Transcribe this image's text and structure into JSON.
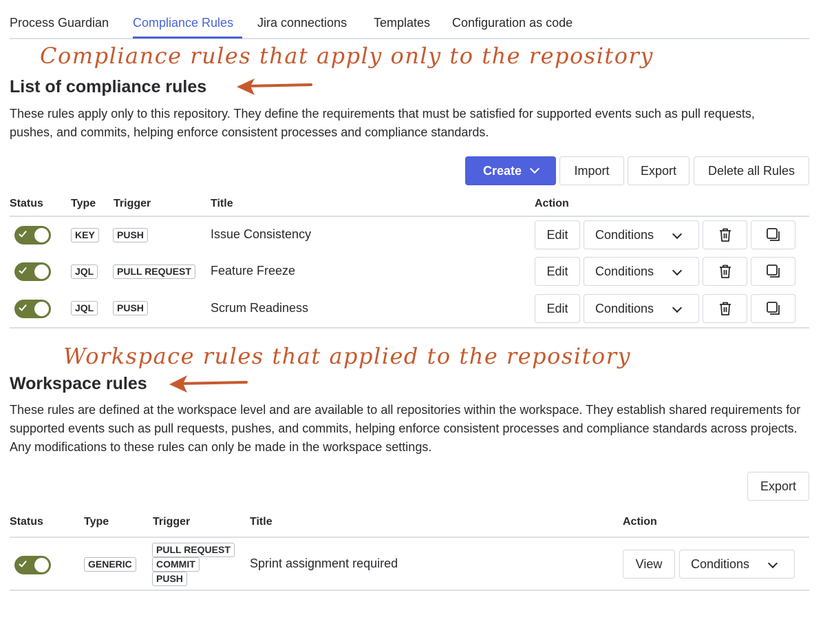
{
  "tabs": [
    {
      "label": "Process Guardian",
      "active": false
    },
    {
      "label": "Compliance Rules",
      "active": true
    },
    {
      "label": "Jira connections",
      "active": false
    },
    {
      "label": "Templates",
      "active": false
    },
    {
      "label": "Configuration as code",
      "active": false
    }
  ],
  "annotations": {
    "compliance": "Compliance rules that apply only to the repository",
    "workspace": "Workspace rules that applied to the repository"
  },
  "compliance": {
    "title": "List of compliance rules",
    "description": "These rules apply only to this repository. They define the requirements that must be satisfied for supported events such as pull requests, pushes, and commits, helping enforce consistent processes and compliance standards.",
    "buttons": {
      "create": "Create",
      "import": "Import",
      "export": "Export",
      "delete_all": "Delete all Rules"
    },
    "columns": {
      "status": "Status",
      "type": "Type",
      "trigger": "Trigger",
      "title": "Title",
      "action": "Action"
    },
    "rows": [
      {
        "enabled": true,
        "type": "KEY",
        "trigger": "PUSH",
        "title": "Issue Consistency",
        "edit": "Edit",
        "conditions": "Conditions",
        "delete_icon": "trash-icon",
        "copy_icon": "copy-icon"
      },
      {
        "enabled": true,
        "type": "JQL",
        "trigger": "PULL REQUEST",
        "title": "Feature Freeze",
        "edit": "Edit",
        "conditions": "Conditions",
        "delete_icon": "trash-icon",
        "copy_icon": "copy-icon"
      },
      {
        "enabled": true,
        "type": "JQL",
        "trigger": "PUSH",
        "title": "Scrum Readiness",
        "edit": "Edit",
        "conditions": "Conditions",
        "delete_icon": "trash-icon",
        "copy_icon": "copy-icon"
      }
    ]
  },
  "workspace": {
    "title": "Workspace rules",
    "description": "These rules are defined at the workspace level and are available to all repositories within the workspace. They establish shared requirements for supported events such as pull requests, pushes, and commits, helping enforce consistent processes and compliance standards across projects. Any modifications to these rules can only be made in the workspace settings.",
    "buttons": {
      "export": "Export"
    },
    "columns": {
      "status": "Status",
      "type": "Type",
      "trigger": "Trigger",
      "title": "Title",
      "action": "Action"
    },
    "rows": [
      {
        "enabled": true,
        "type": "GENERIC",
        "triggers": [
          "PULL REQUEST",
          "COMMIT",
          "PUSH"
        ],
        "title": "Sprint assignment required",
        "view": "View",
        "conditions": "Conditions"
      }
    ]
  },
  "colors": {
    "accent": "#4f61dc",
    "toggle_on": "#6a7b3a",
    "annotation": "#c65a2e"
  }
}
